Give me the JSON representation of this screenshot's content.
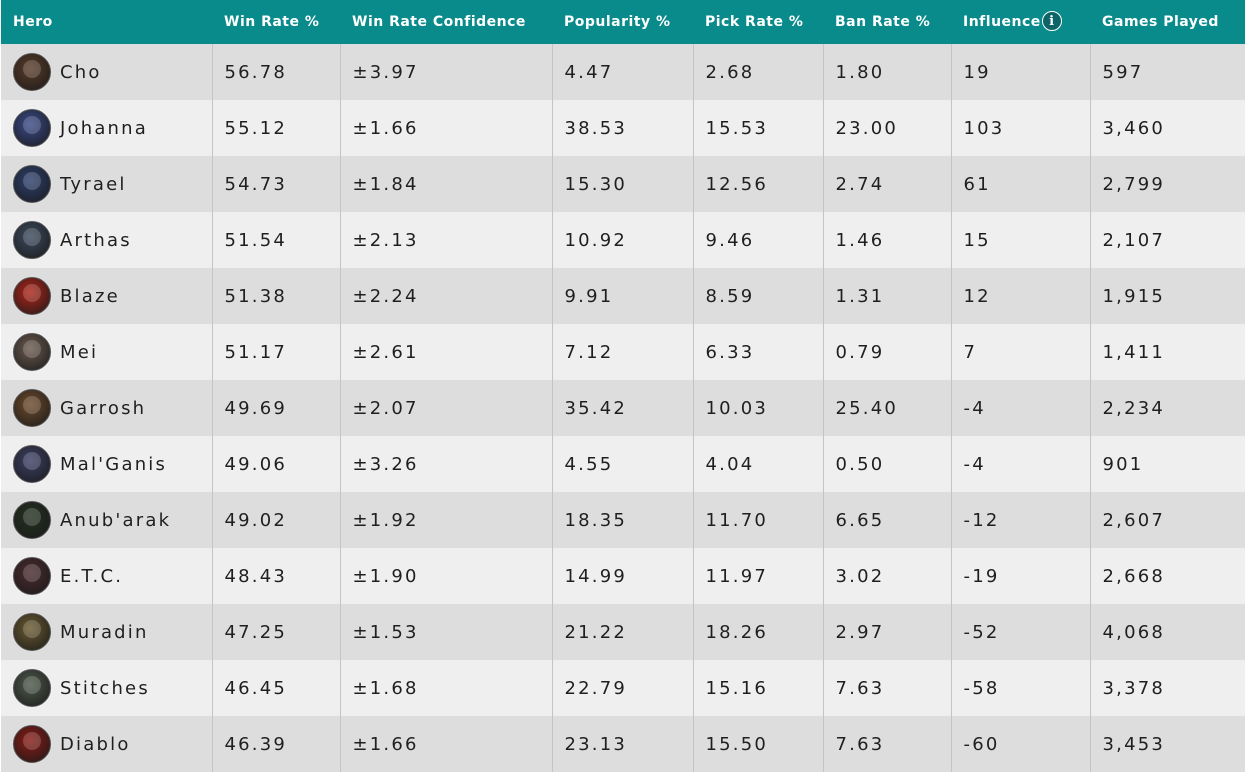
{
  "columns": {
    "hero": "Hero",
    "win_rate": "Win Rate %",
    "win_rate_confidence": "Win Rate Confidence",
    "popularity": "Popularity %",
    "pick_rate": "Pick Rate %",
    "ban_rate": "Ban Rate %",
    "influence": "Influence",
    "games_played": "Games Played"
  },
  "influence_info_glyph": "i",
  "rows": [
    {
      "hero": "Cho",
      "win_rate": "56.78",
      "confidence": "±3.97",
      "popularity": "4.47",
      "pick_rate": "2.68",
      "ban_rate": "1.80",
      "influence": "19",
      "games": "597",
      "avatar_color": "#5a3b28"
    },
    {
      "hero": "Johanna",
      "win_rate": "55.12",
      "confidence": "±1.66",
      "popularity": "38.53",
      "pick_rate": "15.53",
      "ban_rate": "23.00",
      "influence": "103",
      "games": "3,460",
      "avatar_color": "#3a4a8a"
    },
    {
      "hero": "Tyrael",
      "win_rate": "54.73",
      "confidence": "±1.84",
      "popularity": "15.30",
      "pick_rate": "12.56",
      "ban_rate": "2.74",
      "influence": "61",
      "games": "2,799",
      "avatar_color": "#2c3f6e"
    },
    {
      "hero": "Arthas",
      "win_rate": "51.54",
      "confidence": "±2.13",
      "popularity": "10.92",
      "pick_rate": "9.46",
      "ban_rate": "1.46",
      "influence": "15",
      "games": "2,107",
      "avatar_color": "#3b4a5e"
    },
    {
      "hero": "Blaze",
      "win_rate": "51.38",
      "confidence": "±2.24",
      "popularity": "9.91",
      "pick_rate": "8.59",
      "ban_rate": "1.31",
      "influence": "12",
      "games": "1,915",
      "avatar_color": "#b02418"
    },
    {
      "hero": "Mei",
      "win_rate": "51.17",
      "confidence": "±2.61",
      "popularity": "7.12",
      "pick_rate": "6.33",
      "ban_rate": "0.79",
      "influence": "7",
      "games": "1,411",
      "avatar_color": "#6b5a4e"
    },
    {
      "hero": "Garrosh",
      "win_rate": "49.69",
      "confidence": "±2.07",
      "popularity": "35.42",
      "pick_rate": "10.03",
      "ban_rate": "25.40",
      "influence": "-4",
      "games": "2,234",
      "avatar_color": "#6e4a2a"
    },
    {
      "hero": "Mal'Ganis",
      "win_rate": "49.06",
      "confidence": "±3.26",
      "popularity": "4.55",
      "pick_rate": "4.04",
      "ban_rate": "0.50",
      "influence": "-4",
      "games": "901",
      "avatar_color": "#3c3f66"
    },
    {
      "hero": "Anub'arak",
      "win_rate": "49.02",
      "confidence": "±1.92",
      "popularity": "18.35",
      "pick_rate": "11.70",
      "ban_rate": "6.65",
      "influence": "-12",
      "games": "2,607",
      "avatar_color": "#23301f"
    },
    {
      "hero": "E.T.C.",
      "win_rate": "48.43",
      "confidence": "±1.90",
      "popularity": "14.99",
      "pick_rate": "11.97",
      "ban_rate": "3.02",
      "influence": "-19",
      "games": "2,668",
      "avatar_color": "#4a2a2e"
    },
    {
      "hero": "Muradin",
      "win_rate": "47.25",
      "confidence": "±1.53",
      "popularity": "21.22",
      "pick_rate": "18.26",
      "ban_rate": "2.97",
      "influence": "-52",
      "games": "4,068",
      "avatar_color": "#6b5a30"
    },
    {
      "hero": "Stitches",
      "win_rate": "46.45",
      "confidence": "±1.68",
      "popularity": "22.79",
      "pick_rate": "15.16",
      "ban_rate": "7.63",
      "influence": "-58",
      "games": "3,378",
      "avatar_color": "#4e5a4a"
    },
    {
      "hero": "Diablo",
      "win_rate": "46.39",
      "confidence": "±1.66",
      "popularity": "23.13",
      "pick_rate": "15.50",
      "ban_rate": "7.63",
      "influence": "-60",
      "games": "3,453",
      "avatar_color": "#8a1a14"
    }
  ]
}
